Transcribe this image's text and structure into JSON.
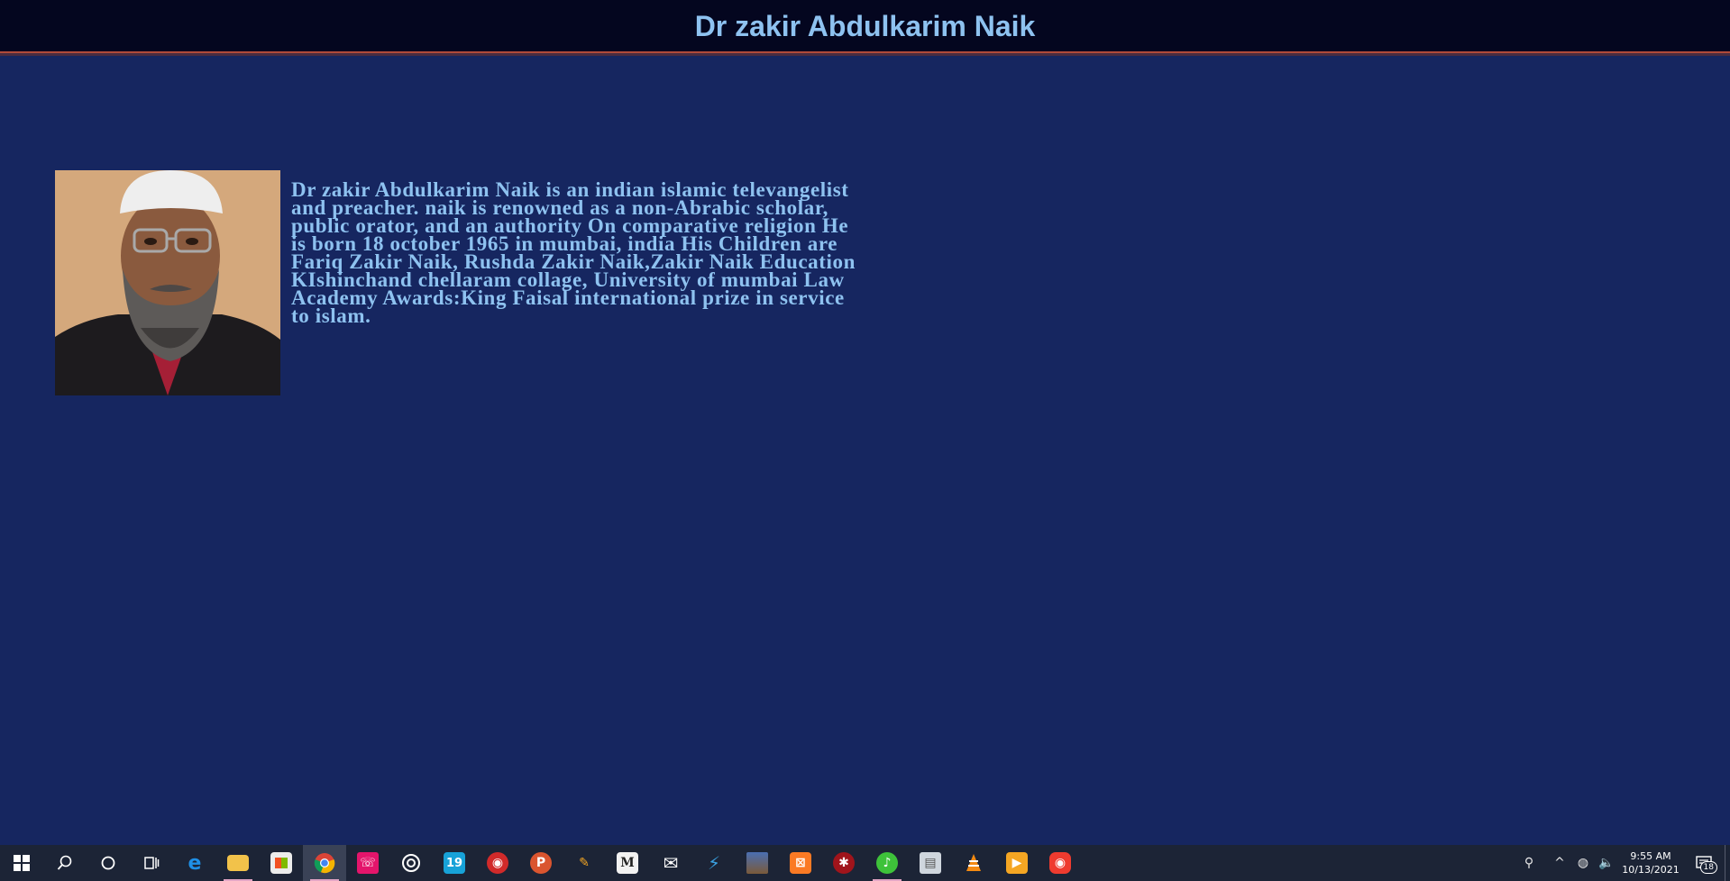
{
  "page": {
    "title": "Dr zakir Abdulkarim Naik",
    "bio": "Dr zakir Abdulkarim Naik is an indian islamic televangelist and preacher. naik is renowned as a non-Abrabic scholar, public orator, and an authority On comparative religion He is born 18 october 1965 in mumbai, india His Children are Fariq Zakir Naik, Rushda Zakir Naik,Zakir Naik Education KIshinchand chellaram collage, University of mumbai Law Academy Awards:King Faisal international prize in service to islam.",
    "photo_alt": "portrait photo"
  },
  "colors": {
    "page_bg": "#162660",
    "header_bg": "#04061f",
    "text": "#8ec2f0",
    "header_rule": "#b04a3a"
  },
  "taskbar": {
    "apps": [
      {
        "name": "start-icon"
      },
      {
        "name": "search-icon"
      },
      {
        "name": "cortana-icon"
      },
      {
        "name": "task-view-icon"
      },
      {
        "name": "edge-icon"
      },
      {
        "name": "file-explorer-icon"
      },
      {
        "name": "store-icon"
      },
      {
        "name": "chrome-icon"
      },
      {
        "name": "whatsapp-icon"
      },
      {
        "name": "groove-icon"
      },
      {
        "name": "app-19-icon",
        "glyph": "19"
      },
      {
        "name": "screen-recorder-icon"
      },
      {
        "name": "product-hunt-icon",
        "glyph": "P"
      },
      {
        "name": "paint-brush-icon"
      },
      {
        "name": "gmail-icon",
        "glyph": "M"
      },
      {
        "name": "mail-icon"
      },
      {
        "name": "visual-studio-icon"
      },
      {
        "name": "photos-icon"
      },
      {
        "name": "xampp-icon"
      },
      {
        "name": "red-circle-app-icon"
      },
      {
        "name": "green-music-app-icon"
      },
      {
        "name": "scanner-icon"
      },
      {
        "name": "vlc-icon"
      },
      {
        "name": "video-player-icon"
      },
      {
        "name": "camera-app-icon"
      }
    ],
    "clock_time": "9:55 AM",
    "clock_date": "10/13/2021",
    "notification_count": "18"
  }
}
